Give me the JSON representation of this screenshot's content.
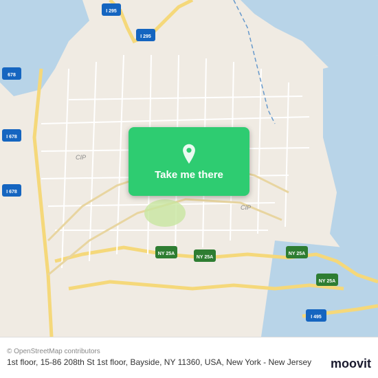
{
  "map": {
    "backgroundColor": "#e8e0d8"
  },
  "button": {
    "label": "Take me there",
    "bg_color": "#2ecc71"
  },
  "footer": {
    "attribution": "© OpenStreetMap contributors",
    "address": "1st floor, 15-86 208th St 1st floor, Bayside, NY 11360, USA, New York - New Jersey"
  },
  "branding": {
    "logo": "moovit"
  }
}
